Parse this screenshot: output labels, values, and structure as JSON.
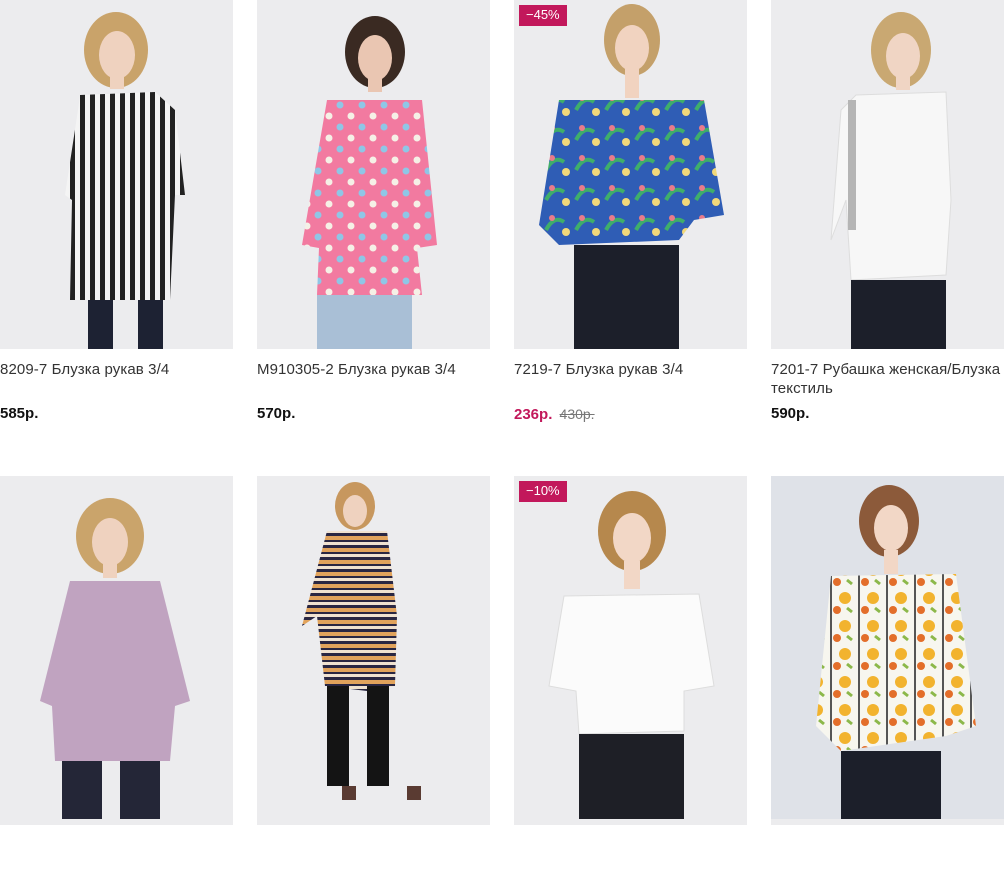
{
  "products": [
    {
      "name": "8209-7 Блузка рукав 3/4",
      "price": "585р.",
      "old_price": "",
      "badge": ""
    },
    {
      "name": "M910305-2 Блузка рукав 3/4",
      "price": "570р.",
      "old_price": "",
      "badge": ""
    },
    {
      "name": "7219-7 Блузка рукав 3/4",
      "price": "236р.",
      "old_price": "430р.",
      "badge": "−45%"
    },
    {
      "name": "7201-7 Рубашка женская/Блузка текстиль",
      "price": "590р.",
      "old_price": "",
      "badge": ""
    },
    {
      "name": "",
      "price": "",
      "old_price": "",
      "badge": ""
    },
    {
      "name": "",
      "price": "",
      "old_price": "",
      "badge": ""
    },
    {
      "name": "",
      "price": "",
      "old_price": "",
      "badge": "−10%"
    },
    {
      "name": "",
      "price": "",
      "old_price": "",
      "badge": ""
    }
  ],
  "colors": {
    "sale": "#c2185b",
    "photo_bg": "#ececee"
  }
}
